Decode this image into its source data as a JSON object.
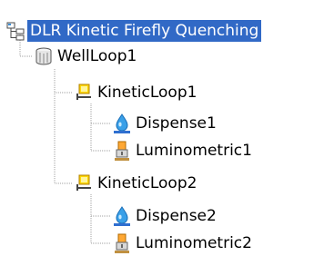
{
  "colors": {
    "selection_bg": "#3169c6",
    "selection_fg": "#ffffff",
    "tree_line": "#a0a0a0"
  },
  "tree": {
    "root": {
      "label": "DLR Kinetic Firefly Quenching",
      "icon": "protocol-tree-icon",
      "selected": true
    },
    "well_loop": {
      "label": "WellLoop1",
      "icon": "well-plate-icon"
    },
    "kinetic_loop_1": {
      "label": "KineticLoop1",
      "icon": "kinetic-loop-icon",
      "dispense": {
        "label": "Dispense1",
        "icon": "dispense-drop-icon"
      },
      "luminometric": {
        "label": "Luminometric1",
        "icon": "luminometric-icon"
      }
    },
    "kinetic_loop_2": {
      "label": "KineticLoop2",
      "icon": "kinetic-loop-icon",
      "dispense": {
        "label": "Dispense2",
        "icon": "dispense-drop-icon"
      },
      "luminometric": {
        "label": "Luminometric2",
        "icon": "luminometric-icon"
      }
    }
  }
}
